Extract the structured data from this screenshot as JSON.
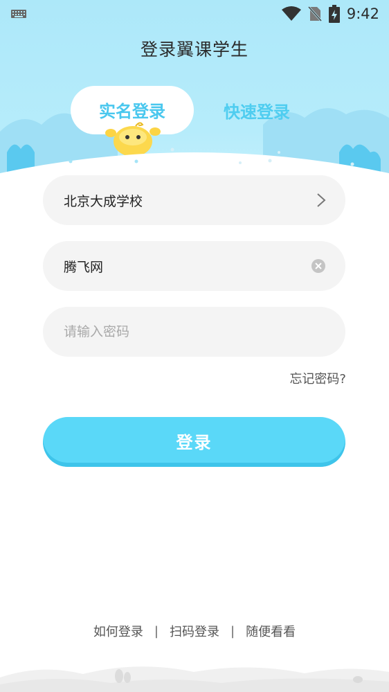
{
  "status_bar": {
    "time": "9:42"
  },
  "app": {
    "title": "登录翼课学生"
  },
  "tabs": [
    {
      "label": "实名登录",
      "active": true
    },
    {
      "label": "快速登录",
      "active": false
    }
  ],
  "form": {
    "school": {
      "value": "北京大成学校"
    },
    "username": {
      "value": "腾飞网"
    },
    "password": {
      "placeholder": "请输入密码",
      "value": ""
    },
    "forgot_label": "忘记密码?",
    "login_label": "登录"
  },
  "footer": {
    "links": [
      "如何登录",
      "扫码登录",
      "随便看看"
    ],
    "separator": "|"
  },
  "colors": {
    "accent": "#5ad8f8",
    "tab_active": "#49c7ee",
    "header_bg": "#b6ecfb",
    "field_bg": "#f4f4f4"
  }
}
